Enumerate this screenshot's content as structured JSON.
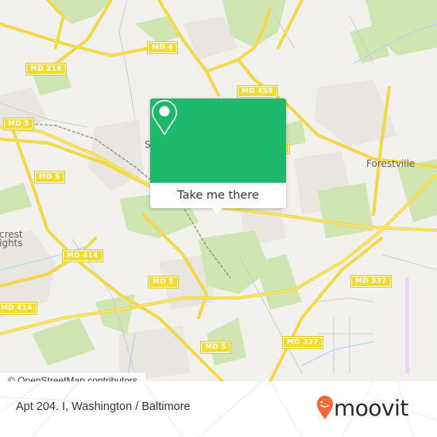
{
  "map": {
    "road_shields": [
      {
        "id": "md-4",
        "label": "MD 4"
      },
      {
        "id": "md-218",
        "label": "MD 218"
      },
      {
        "id": "md-458",
        "label": "MD 458"
      },
      {
        "id": "md-5-a",
        "label": "MD 5"
      },
      {
        "id": "md-5-b",
        "label": "MD 5"
      },
      {
        "id": "md-4-partial",
        "label": "4"
      },
      {
        "id": "md-414-a",
        "label": "MD 414"
      },
      {
        "id": "md-414-b",
        "label": "MD 414"
      },
      {
        "id": "md-5-c",
        "label": "MD 5"
      },
      {
        "id": "md-337-a",
        "label": "MD 337"
      },
      {
        "id": "md-5-d",
        "label": "MD 5"
      },
      {
        "id": "md-337-b",
        "label": "MD 337"
      }
    ],
    "places": [
      {
        "id": "forestville",
        "label": "Forestville"
      },
      {
        "id": "hillcrest-1",
        "label": "crest"
      },
      {
        "id": "hillcrest-2",
        "label": "ights"
      },
      {
        "id": "suitland",
        "label": "S"
      }
    ],
    "colors": {
      "background": "#f2f1ee",
      "road_major": "#f5dc2a",
      "park": "#cfe7b0",
      "water": "#a9d3f0",
      "residential": "#e8e4e0"
    }
  },
  "popup": {
    "icon": "location-pin-icon",
    "button_label": "Take me there",
    "accent_color": "#1db86a"
  },
  "attribution": "© OpenStreetMap contributors",
  "footer": {
    "address": "Apt 204. I, Washington / Baltimore",
    "brand": "moovit",
    "brand_color": "#f26a36"
  }
}
